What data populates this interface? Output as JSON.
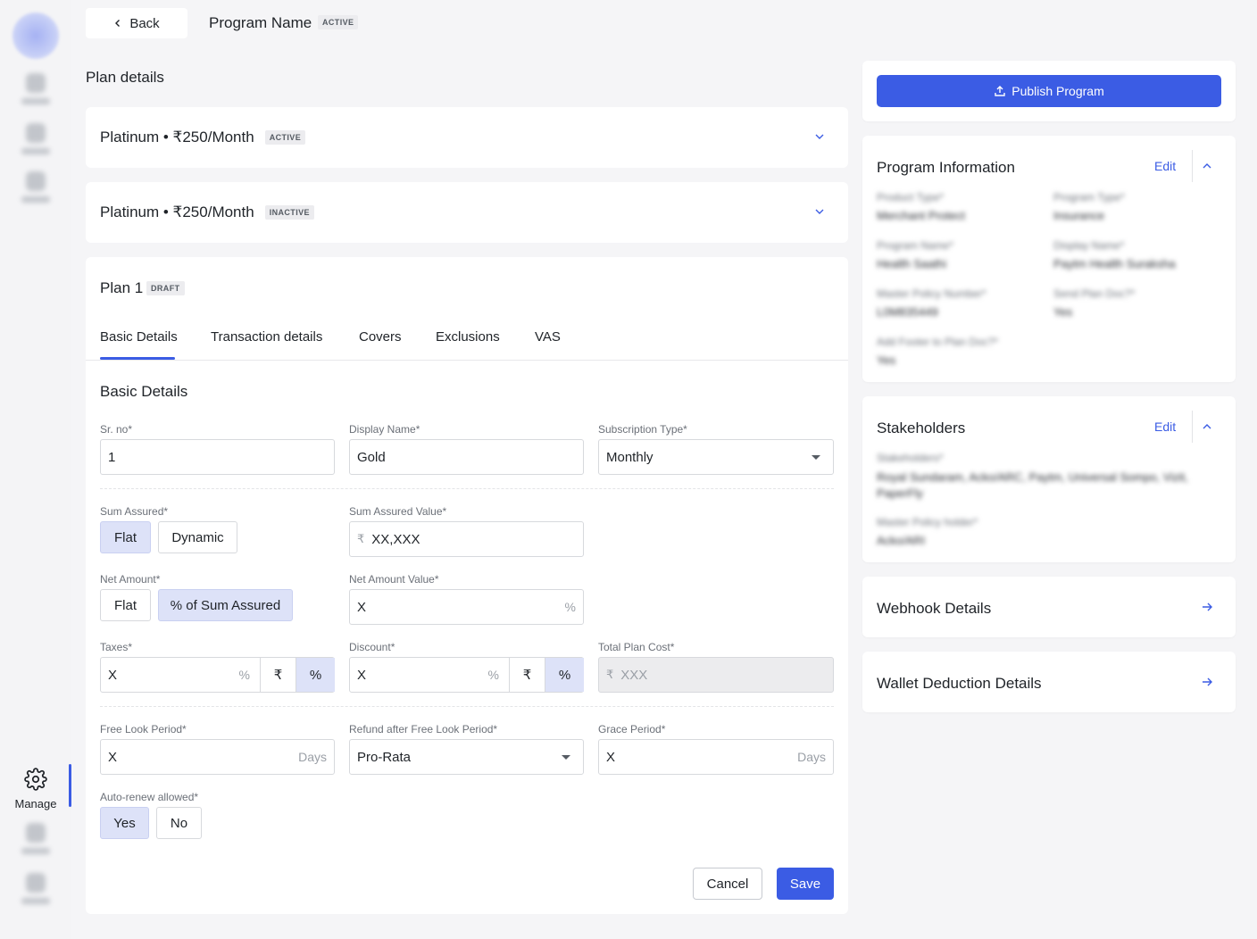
{
  "header": {
    "back_label": "Back",
    "program_name": "Program Name",
    "program_status": "ACTIVE"
  },
  "sidebar": {
    "manage_label": "Manage"
  },
  "plan_details": {
    "title": "Plan details",
    "plans": [
      {
        "name": "Platinum • ₹250/Month",
        "status": "ACTIVE"
      },
      {
        "name": "Platinum • ₹250/Month",
        "status": "INACTIVE"
      }
    ]
  },
  "plan1": {
    "title": "Plan 1",
    "status": "DRAFT",
    "tabs": [
      "Basic Details",
      "Transaction details",
      "Covers",
      "Exclusions",
      "VAS"
    ],
    "section_title": "Basic Details",
    "fields": {
      "sr_no": {
        "label": "Sr. no*",
        "value": "1"
      },
      "display_name": {
        "label": "Display Name*",
        "value": "Gold"
      },
      "subscription_type": {
        "label": "Subscription Type*",
        "value": "Monthly"
      },
      "sum_assured": {
        "label": "Sum Assured*",
        "options": [
          "Flat",
          "Dynamic"
        ],
        "selected": "Flat"
      },
      "sum_assured_value": {
        "label": "Sum Assured Value*",
        "prefix": "₹",
        "value": "XX,XXX"
      },
      "net_amount": {
        "label": "Net Amount*",
        "options": [
          "Flat",
          "% of Sum Assured"
        ],
        "selected": "% of Sum Assured"
      },
      "net_amount_value": {
        "label": "Net Amount Value*",
        "value": "X",
        "suffix": "%"
      },
      "taxes": {
        "label": "Taxes*",
        "value": "X",
        "suffix": "%",
        "options": [
          "₹",
          "%"
        ],
        "selected": "%"
      },
      "discount": {
        "label": "Discount*",
        "value": "X",
        "suffix": "%",
        "options": [
          "₹",
          "%"
        ],
        "selected": "%"
      },
      "total_plan_cost": {
        "label": "Total Plan Cost*",
        "prefix": "₹",
        "value": "XXX"
      },
      "free_look_period": {
        "label": "Free Look Period*",
        "value": "X",
        "suffix": "Days"
      },
      "refund": {
        "label": "Refund after Free Look Period*",
        "value": "Pro-Rata"
      },
      "grace_period": {
        "label": "Grace Period*",
        "value": "X",
        "suffix": "Days"
      },
      "auto_renew": {
        "label": "Auto-renew allowed*",
        "options": [
          "Yes",
          "No"
        ],
        "selected": "Yes"
      }
    },
    "actions": {
      "cancel": "Cancel",
      "save": "Save"
    }
  },
  "right": {
    "publish_label": "Publish Program",
    "program_info": {
      "title": "Program Information",
      "edit": "Edit",
      "items": [
        {
          "label": "Product Type*",
          "value": "Merchant Protect"
        },
        {
          "label": "Program Type*",
          "value": "Insurance"
        },
        {
          "label": "Program Name*",
          "value": "Health Saathi"
        },
        {
          "label": "Display Name*",
          "value": "Paytm Health Suraksha"
        },
        {
          "label": "Master Policy Number*",
          "value": "L0M835449"
        },
        {
          "label": "Send Plan Doc?*",
          "value": "Yes"
        },
        {
          "label": "Add Footer to Plan Doc?*",
          "value": "Yes"
        }
      ]
    },
    "stakeholders": {
      "title": "Stakeholders",
      "edit": "Edit",
      "items": [
        {
          "label": "Stakeholders*",
          "value": "Royal Sundaram, Acko/ARC, Paytm, Universal Sompo, Vizit, PaperFly"
        },
        {
          "label": "Master Policy holder*",
          "value": "Acko/ARI"
        }
      ]
    },
    "webhook_title": "Webhook Details",
    "wallet_title": "Wallet Deduction Details"
  },
  "colors": {
    "accent": "#3b5ce4",
    "selected_segment": "#dde2f8",
    "page_bg": "#f5f5f7"
  }
}
